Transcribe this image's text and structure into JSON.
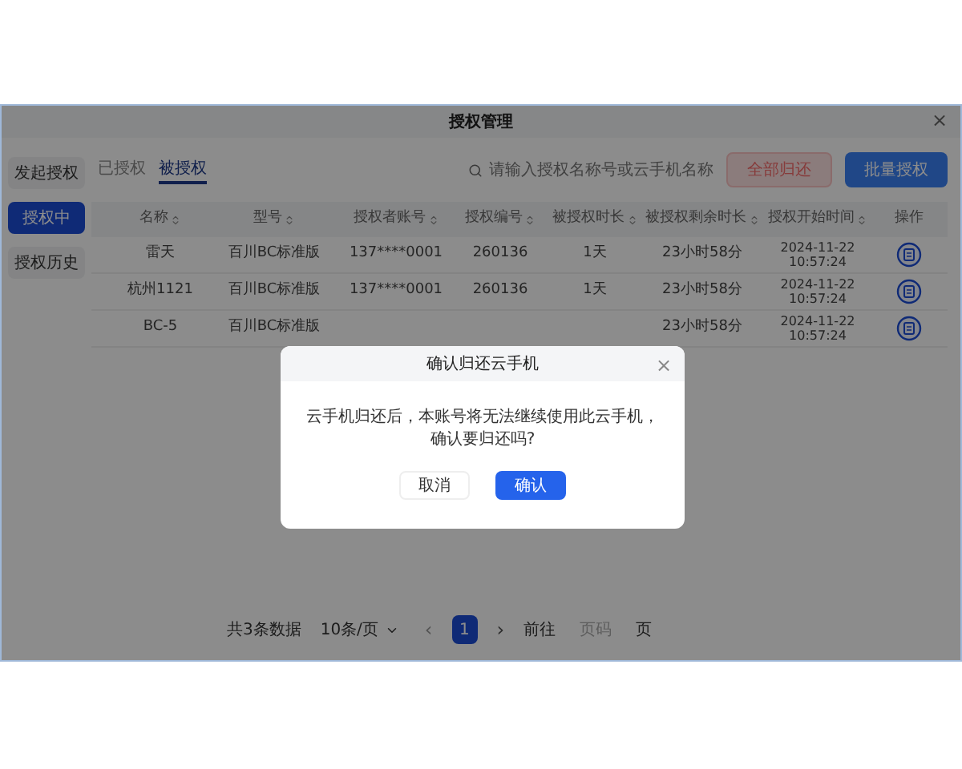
{
  "window": {
    "title": "授权管理",
    "close": "×"
  },
  "sidebar": {
    "items": [
      {
        "label": "发起授权",
        "selected": false
      },
      {
        "label": "授权中",
        "selected": true
      },
      {
        "label": "授权历史",
        "selected": false
      }
    ]
  },
  "tabs": [
    {
      "label": "已授权",
      "selected": false
    },
    {
      "label": "被授权",
      "selected": true
    }
  ],
  "search": {
    "placeholder": "请输入授权名称号或云手机名称"
  },
  "toolbar_buttons": [
    {
      "label": "全部归还",
      "kind": "danger"
    },
    {
      "label": "批量授权",
      "kind": "primary"
    }
  ],
  "table": {
    "columns": [
      "名称",
      "型号",
      "授权者账号",
      "授权编号",
      "被授权时长",
      "被授权剩余时长",
      "授权开始时间",
      "操作"
    ],
    "rows": [
      {
        "name": "雷天",
        "model": "百川BC标准版",
        "account": "137****0001",
        "code": "260136",
        "duration": "1天",
        "remaining": "23小时58分",
        "date": "2024-11-22",
        "time": "10:57:24"
      },
      {
        "name": "杭州1121",
        "model": "百川BC标准版",
        "account": "137****0001",
        "code": "260136",
        "duration": "1天",
        "remaining": "23小时58分",
        "date": "2024-11-22",
        "time": "10:57:24"
      },
      {
        "name": "BC-5",
        "model": "百川BC标准版",
        "remaining": "23小时58分",
        "date": "2024-11-22",
        "time": "10:57:24"
      }
    ]
  },
  "pagination": {
    "total": "共3条数据",
    "page_size": "10条/页",
    "prev": "‹",
    "pages": [
      {
        "label": "1",
        "selected": true
      }
    ],
    "next": "›",
    "goto": "前往",
    "goto_placeholder": "页码",
    "goto_suffix": "页"
  },
  "dialog": {
    "title": "确认归还云手机",
    "close": "×",
    "message": [
      "云手机归还后，本账号将无法继续使用此云手机，",
      "确认要归还吗?"
    ],
    "buttons": [
      {
        "label": "取消",
        "kind": "secondary"
      },
      {
        "label": "确认",
        "kind": "primary"
      }
    ]
  }
}
